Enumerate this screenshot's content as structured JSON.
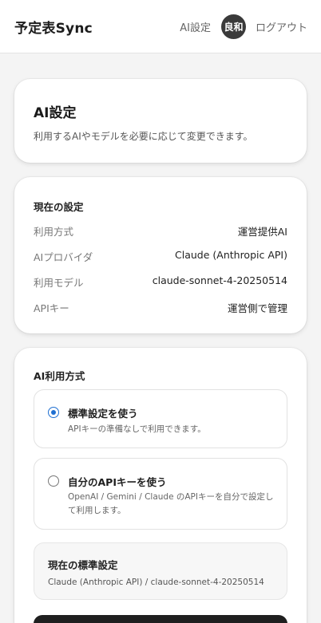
{
  "header": {
    "brand": "予定表Sync",
    "nav_ai_settings": "AI設定",
    "avatar_initials": "良和",
    "logout": "ログアウト"
  },
  "intro": {
    "title": "AI設定",
    "description": "利用するAIやモデルを必要に応じて変更できます。"
  },
  "current": {
    "title": "現在の設定",
    "rows": [
      {
        "label": "利用方式",
        "value": "運営提供AI"
      },
      {
        "label": "AIプロバイダ",
        "value": "Claude (Anthropic API)"
      },
      {
        "label": "利用モデル",
        "value": "claude-sonnet-4-20250514"
      },
      {
        "label": "APIキー",
        "value": "運営側で管理"
      }
    ]
  },
  "usage": {
    "title": "AI利用方式",
    "options": [
      {
        "title": "標準設定を使う",
        "description": "APIキーの準備なしで利用できます。",
        "selected": true
      },
      {
        "title": "自分のAPIキーを使う",
        "description": "OpenAI / Gemini / Claude のAPIキーを自分で設定して利用します。",
        "selected": false
      }
    ],
    "standard_box": {
      "title": "現在の標準設定",
      "description": "Claude (Anthropic API) / claude-sonnet-4-20250514"
    }
  },
  "colors": {
    "accent": "#1f6fd1",
    "avatar_bg": "#3a3a3a",
    "page_bg": "#f4f4f4"
  }
}
